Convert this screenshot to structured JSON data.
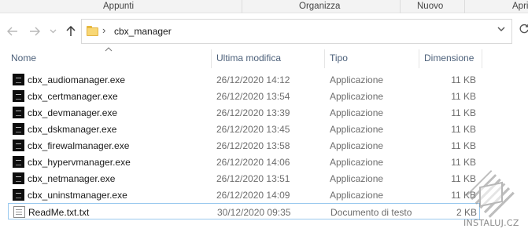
{
  "ribbon": {
    "groups": [
      "Appunti",
      "Organizza",
      "Nuovo",
      "Apri"
    ]
  },
  "nav": {
    "back_icon": "arrow-left-icon",
    "forward_icon": "arrow-right-icon",
    "recent_icon": "chevron-down-icon",
    "up_icon": "arrow-up-icon"
  },
  "address": {
    "path": "cbx_manager",
    "separator": "›",
    "folder_icon": "folder-icon"
  },
  "columns": {
    "name": "Nome",
    "modified": "Ultima modifica",
    "type": "Tipo",
    "size": "Dimensione"
  },
  "files": [
    {
      "name": "cbx_audiomanager.exe",
      "modified": "26/12/2020 14:12",
      "type": "Applicazione",
      "size": "11 KB",
      "icon": "exe"
    },
    {
      "name": "cbx_certmanager.exe",
      "modified": "26/12/2020 13:54",
      "type": "Applicazione",
      "size": "11 KB",
      "icon": "exe"
    },
    {
      "name": "cbx_devmanager.exe",
      "modified": "26/12/2020 13:39",
      "type": "Applicazione",
      "size": "11 KB",
      "icon": "exe"
    },
    {
      "name": "cbx_dskmanager.exe",
      "modified": "26/12/2020 13:45",
      "type": "Applicazione",
      "size": "11 KB",
      "icon": "exe"
    },
    {
      "name": "cbx_firewalmanager.exe",
      "modified": "26/12/2020 13:58",
      "type": "Applicazione",
      "size": "11 KB",
      "icon": "exe"
    },
    {
      "name": "cbx_hypervmanager.exe",
      "modified": "26/12/2020 14:06",
      "type": "Applicazione",
      "size": "11 KB",
      "icon": "exe"
    },
    {
      "name": "cbx_netmanager.exe",
      "modified": "26/12/2020 13:51",
      "type": "Applicazione",
      "size": "11 KB",
      "icon": "exe"
    },
    {
      "name": "cbx_uninstmanager.exe",
      "modified": "26/12/2020 14:09",
      "type": "Applicazione",
      "size": "11 KB",
      "icon": "exe"
    },
    {
      "name": "ReadMe.txt.txt",
      "modified": "30/12/2020 09:35",
      "type": "Documento di testo",
      "size": "2 KB",
      "icon": "txt"
    }
  ],
  "selected_index": 8,
  "watermark": {
    "text": "INSTALUJ.CZ"
  },
  "colors": {
    "header_text": "#4c607a",
    "selection_border": "#99c9ef",
    "muted_text": "#6d6d6d"
  }
}
